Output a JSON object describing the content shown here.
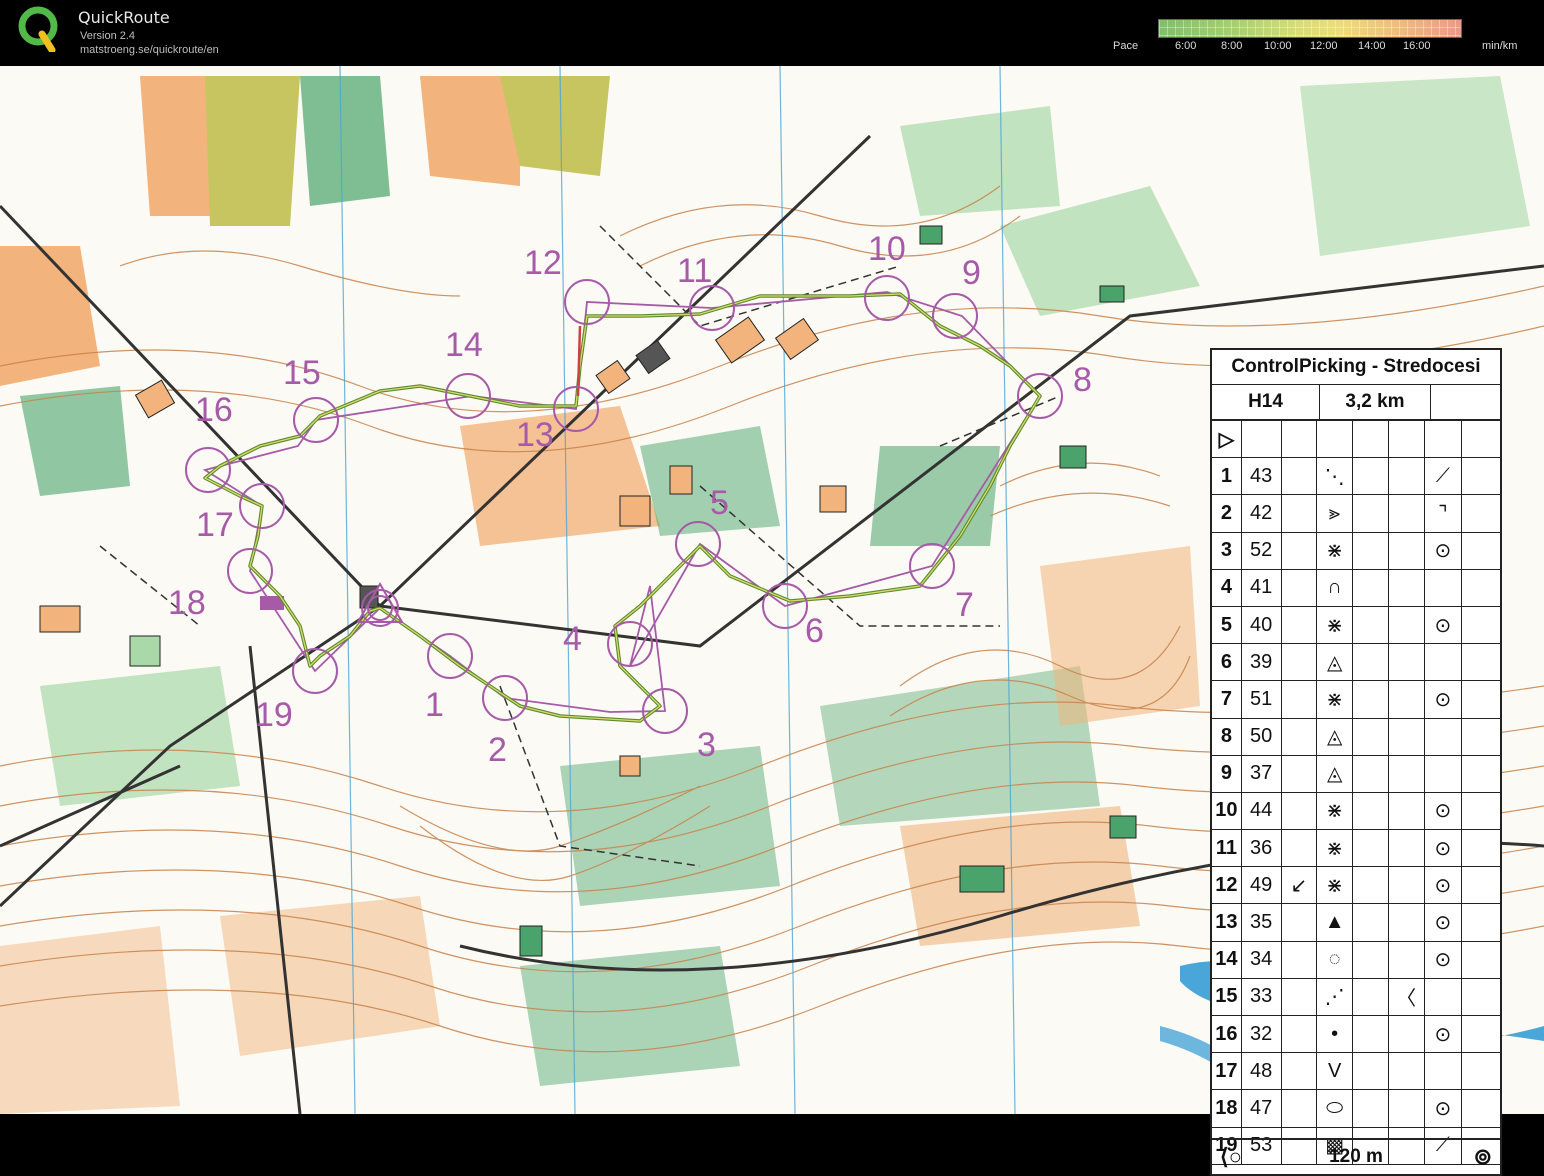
{
  "app": {
    "title": "QuickRoute",
    "version": "Version 2.4",
    "url": "matstroeng.se/quickroute/en"
  },
  "pace_scale": {
    "label": "Pace",
    "unit": "min/km",
    "ticks": [
      "6:00",
      "8:00",
      "10:00",
      "12:00",
      "14:00",
      "16:00"
    ]
  },
  "map": {
    "control_numbers": [
      "1",
      "2",
      "3",
      "4",
      "5",
      "6",
      "7",
      "8",
      "9",
      "10",
      "11",
      "12",
      "13",
      "14",
      "15",
      "16",
      "17",
      "18",
      "19"
    ],
    "colors": {
      "course": "#a65aa8",
      "route": "#5d8a2e",
      "contour": "#c8824a",
      "forest": "#4aa36a",
      "open": "#f2b47c",
      "water": "#4aa5d8"
    }
  },
  "legend": {
    "title": "ControlPicking - Stredocesi",
    "category": "H14",
    "length": "3,2 km",
    "rows": [
      {
        "n": "1",
        "code": "43",
        "c": "",
        "d": "⋱",
        "g": "⟋"
      },
      {
        "n": "2",
        "code": "42",
        "c": "",
        "d": "⪢",
        "g": "⌝"
      },
      {
        "n": "3",
        "code": "52",
        "c": "",
        "d": "⋇",
        "g": "⊙"
      },
      {
        "n": "4",
        "code": "41",
        "c": "",
        "d": "∩",
        "g": ""
      },
      {
        "n": "5",
        "code": "40",
        "c": "",
        "d": "⋇",
        "g": "⊙"
      },
      {
        "n": "6",
        "code": "39",
        "c": "",
        "d": "◬",
        "g": ""
      },
      {
        "n": "7",
        "code": "51",
        "c": "",
        "d": "⋇",
        "g": "⊙"
      },
      {
        "n": "8",
        "code": "50",
        "c": "",
        "d": "◬",
        "g": ""
      },
      {
        "n": "9",
        "code": "37",
        "c": "",
        "d": "◬",
        "g": ""
      },
      {
        "n": "10",
        "code": "44",
        "c": "",
        "d": "⋇",
        "g": "⊙"
      },
      {
        "n": "11",
        "code": "36",
        "c": "",
        "d": "⋇",
        "g": "⊙"
      },
      {
        "n": "12",
        "code": "49",
        "c": "↙",
        "d": "⋇",
        "g": "⊙"
      },
      {
        "n": "13",
        "code": "35",
        "c": "",
        "d": "▲",
        "g": "⊙"
      },
      {
        "n": "14",
        "code": "34",
        "c": "",
        "d": "◌",
        "g": "⊙"
      },
      {
        "n": "15",
        "code": "33",
        "c": "",
        "d": "⋰",
        "f": "〈",
        "g": ""
      },
      {
        "n": "16",
        "code": "32",
        "c": "",
        "d": "•",
        "g": "⊙"
      },
      {
        "n": "17",
        "code": "48",
        "c": "",
        "d": "V",
        "g": ""
      },
      {
        "n": "18",
        "code": "47",
        "c": "",
        "d": "⬭",
        "g": "⊙"
      },
      {
        "n": "19",
        "code": "53",
        "c": "",
        "d": "▩",
        "g": "⟋"
      }
    ],
    "footer": "120 m"
  }
}
